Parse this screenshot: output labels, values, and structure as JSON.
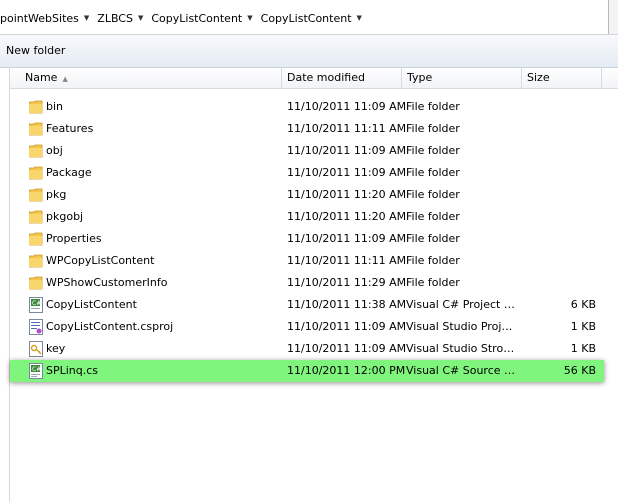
{
  "breadcrumb": {
    "items": [
      "pointWebSites",
      "ZLBCS",
      "CopyListContent",
      "CopyListContent"
    ]
  },
  "toolbar": {
    "new_folder_label": "New folder"
  },
  "columns": {
    "name": "Name",
    "date": "Date modified",
    "type": "Type",
    "size": "Size"
  },
  "files": [
    {
      "name": "bin",
      "date": "11/10/2011 11:09 AM",
      "type": "File folder",
      "size": "",
      "icon": "folder-icon"
    },
    {
      "name": "Features",
      "date": "11/10/2011 11:11 AM",
      "type": "File folder",
      "size": "",
      "icon": "folder-icon"
    },
    {
      "name": "obj",
      "date": "11/10/2011 11:09 AM",
      "type": "File folder",
      "size": "",
      "icon": "folder-icon"
    },
    {
      "name": "Package",
      "date": "11/10/2011 11:09 AM",
      "type": "File folder",
      "size": "",
      "icon": "folder-icon"
    },
    {
      "name": "pkg",
      "date": "11/10/2011 11:20 AM",
      "type": "File folder",
      "size": "",
      "icon": "folder-icon"
    },
    {
      "name": "pkgobj",
      "date": "11/10/2011 11:20 AM",
      "type": "File folder",
      "size": "",
      "icon": "folder-icon"
    },
    {
      "name": "Properties",
      "date": "11/10/2011 11:09 AM",
      "type": "File folder",
      "size": "",
      "icon": "folder-icon"
    },
    {
      "name": "WPCopyListContent",
      "date": "11/10/2011 11:11 AM",
      "type": "File folder",
      "size": "",
      "icon": "folder-icon"
    },
    {
      "name": "WPShowCustomerInfo",
      "date": "11/10/2011 11:29 AM",
      "type": "File folder",
      "size": "",
      "icon": "folder-icon"
    },
    {
      "name": "CopyListContent",
      "date": "11/10/2011 11:38 AM",
      "type": "Visual C# Project file",
      "size": "6 KB",
      "icon": "csharp-project-icon"
    },
    {
      "name": "CopyListContent.csproj",
      "date": "11/10/2011 11:09 AM",
      "type": "Visual Studio Projec...",
      "size": "1 KB",
      "icon": "vs-project-icon"
    },
    {
      "name": "key",
      "date": "11/10/2011 11:09 AM",
      "type": "Visual Studio Strong...",
      "size": "1 KB",
      "icon": "key-file-icon"
    },
    {
      "name": "SPLinq.cs",
      "date": "11/10/2011 12:00 PM",
      "type": "Visual C# Source file",
      "size": "56 KB",
      "icon": "csharp-source-icon",
      "selected": true
    }
  ],
  "colors": {
    "selection_highlight": "#80f57d",
    "folder_yellow": "#f3c54a"
  }
}
